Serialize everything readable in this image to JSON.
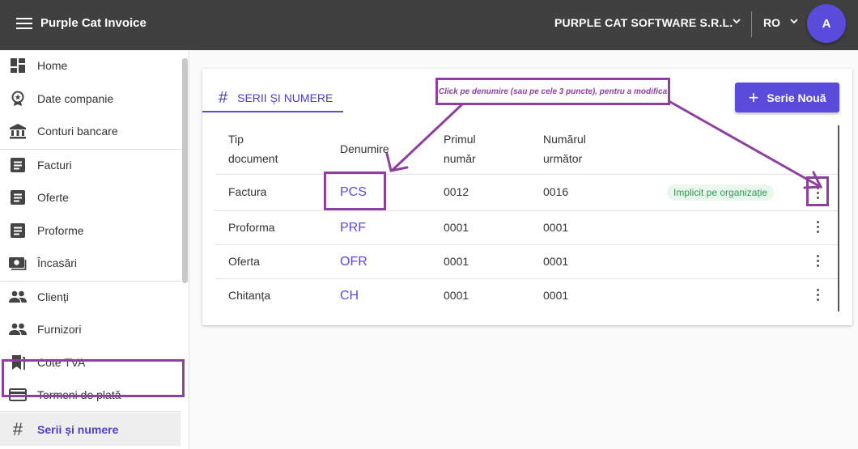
{
  "app": {
    "title": "Purple Cat Invoice"
  },
  "header": {
    "company": "PURPLE CAT SOFTWARE S.R.L.",
    "language": "RO",
    "avatar_initial": "A"
  },
  "sidebar": {
    "items": [
      {
        "label": "Home",
        "icon": "dashboard-icon"
      },
      {
        "label": "Date companie",
        "icon": "badge-icon"
      },
      {
        "label": "Conturi bancare",
        "icon": "bank-icon"
      },
      {
        "label": "Facturi",
        "icon": "document-icon"
      },
      {
        "label": "Oferte",
        "icon": "document-icon"
      },
      {
        "label": "Proforme",
        "icon": "document-icon"
      },
      {
        "label": "Încasări",
        "icon": "cash-icon"
      },
      {
        "label": "Clienți",
        "icon": "people-icon"
      },
      {
        "label": "Furnizori",
        "icon": "people-icon"
      },
      {
        "label": "Cote TVA",
        "icon": "bookmark-icon"
      },
      {
        "label": "Termeni de plată",
        "icon": "credit-card-icon"
      },
      {
        "label": "Serii și numere",
        "icon": "hash-icon"
      }
    ],
    "active_index": 11
  },
  "page": {
    "tab_label": "SERII ȘI NUMERE",
    "new_button_label": "Serie Nouă",
    "annotation": "Click pe denumire (sau pe cele 3 puncte), pentru a modifica"
  },
  "table": {
    "headers": {
      "tip_line1": "Tip",
      "tip_line2": "document",
      "denumire": "Denumire",
      "primul_line1": "Primul",
      "primul_line2": "număr",
      "urmator_line1": "Numărul",
      "urmator_line2": "următor"
    },
    "rows": [
      {
        "tip": "Factura",
        "denumire": "PCS",
        "primul": "0012",
        "urmator": "0016",
        "badge": "Implicit pe organizație"
      },
      {
        "tip": "Proforma",
        "denumire": "PRF",
        "primul": "0001",
        "urmator": "0001",
        "badge": ""
      },
      {
        "tip": "Oferta",
        "denumire": "OFR",
        "primul": "0001",
        "urmator": "0001",
        "badge": ""
      },
      {
        "tip": "Chitanța",
        "denumire": "CH",
        "primul": "0001",
        "urmator": "0001",
        "badge": ""
      }
    ]
  },
  "colors": {
    "primary": "#5b4bdb",
    "topbar": "#404040",
    "annotation": "#8e3fa0",
    "badge_text": "#2e9a4e",
    "badge_bg": "#eaf7ee"
  }
}
